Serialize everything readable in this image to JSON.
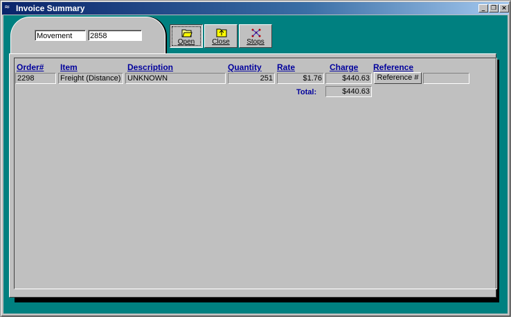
{
  "window": {
    "title": "Invoice Summary"
  },
  "header": {
    "movement_label": "Movement",
    "movement_value": "2858"
  },
  "toolbar": {
    "open_label": "Open",
    "close_label": "Close",
    "stops_label": "Stops"
  },
  "columns": [
    "Order#",
    "Item",
    "Description",
    "Quantity",
    "Rate",
    "Charge",
    "Reference"
  ],
  "row": {
    "order": "2298",
    "item": "Freight (Distance)",
    "description": "UNKNOWN",
    "quantity": "251",
    "rate": "$1.76",
    "charge": "$440.63",
    "reference_button": "Reference #",
    "reference_value": ""
  },
  "totals": {
    "label": "Total:",
    "value": "$440.63"
  },
  "colors": {
    "client_bg": "#008080",
    "header_text": "#00009c",
    "title_bar": "#0a246a"
  }
}
